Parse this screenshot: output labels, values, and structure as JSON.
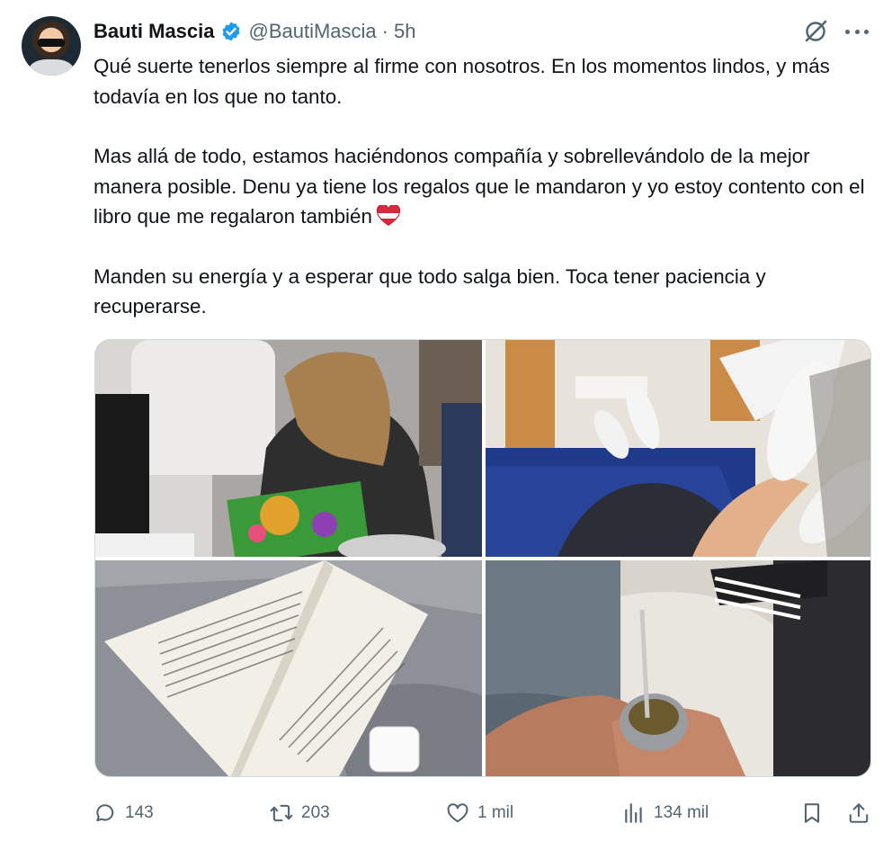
{
  "author": {
    "name": "Bauti Mascia",
    "handle": "@BautiMascia",
    "separator": "·",
    "time": "5h",
    "verified_color": "#1d9bf0"
  },
  "tweet": {
    "paragraphs": [
      "Qué suerte tenerlos siempre al firme con nosotros. En los momentos lindos, y más todavía en los que no tanto.",
      "Mas allá de todo, estamos haciéndonos compañía y sobrellevándolo de la mejor manera posible. Denu ya tiene los regalos que le mandaron y yo estoy contento con el libro que me regalaron también",
      "Manden su energía y a esperar que todo salga bien. Toca tener paciencia y recuperarse."
    ],
    "emoji": "heart-emoji"
  },
  "media": {
    "photos": [
      "photo-drawing",
      "photo-hospital-bed",
      "photo-book",
      "photo-mate"
    ]
  },
  "actions": {
    "replies": "143",
    "retweets": "203",
    "likes": "1 mil",
    "views": "134 mil"
  },
  "icons": [
    "grok-icon",
    "more-icon",
    "reply-icon",
    "retweet-icon",
    "like-icon",
    "views-icon",
    "bookmark-icon",
    "share-icon"
  ],
  "colors": {
    "text": "#0f1419",
    "secondary": "#536471",
    "verified": "#1d9bf0",
    "border": "#cfd9de"
  }
}
